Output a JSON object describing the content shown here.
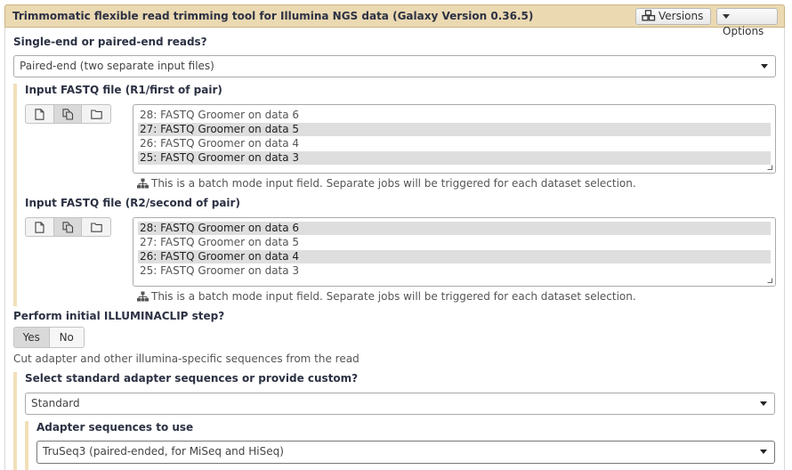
{
  "tool": {
    "title": "Trimmomatic flexible read trimming tool for Illumina NGS data (Galaxy Version 0.36.5)",
    "versions_label": "Versions",
    "options_label": "Options"
  },
  "reads_mode": {
    "label": "Single-end or paired-end reads?",
    "value": "Paired-end (two separate input files)"
  },
  "input_r1": {
    "label": "Input FASTQ file (R1/first of pair)",
    "options": [
      {
        "text": "28: FASTQ Groomer on data 6",
        "selected": false
      },
      {
        "text": "27: FASTQ Groomer on data 5",
        "selected": true
      },
      {
        "text": "26: FASTQ Groomer on data 4",
        "selected": false
      },
      {
        "text": "25: FASTQ Groomer on data 3",
        "selected": true
      }
    ],
    "hint": "This is a batch mode input field. Separate jobs will be triggered for each dataset selection."
  },
  "input_r2": {
    "label": "Input FASTQ file (R2/second of pair)",
    "options": [
      {
        "text": "28: FASTQ Groomer on data 6",
        "selected": true
      },
      {
        "text": "27: FASTQ Groomer on data 5",
        "selected": false
      },
      {
        "text": "26: FASTQ Groomer on data 4",
        "selected": true
      },
      {
        "text": "25: FASTQ Groomer on data 3",
        "selected": false
      }
    ],
    "hint": "This is a batch mode input field. Separate jobs will be triggered for each dataset selection."
  },
  "illuminaclip": {
    "label": "Perform initial ILLUMINACLIP step?",
    "yes_label": "Yes",
    "no_label": "No",
    "selected": "Yes",
    "help": "Cut adapter and other illumina-specific sequences from the read"
  },
  "adapter_type": {
    "label": "Select standard adapter sequences or provide custom?",
    "value": "Standard"
  },
  "adapter_seq": {
    "label": "Adapter sequences to use",
    "value": "TruSeq3 (paired-ended, for MiSeq and HiSeq)"
  },
  "colors": {
    "header_bg": "#ebd9b2",
    "section_bar": "#f1dfb8",
    "selected_option": "#dedede"
  }
}
